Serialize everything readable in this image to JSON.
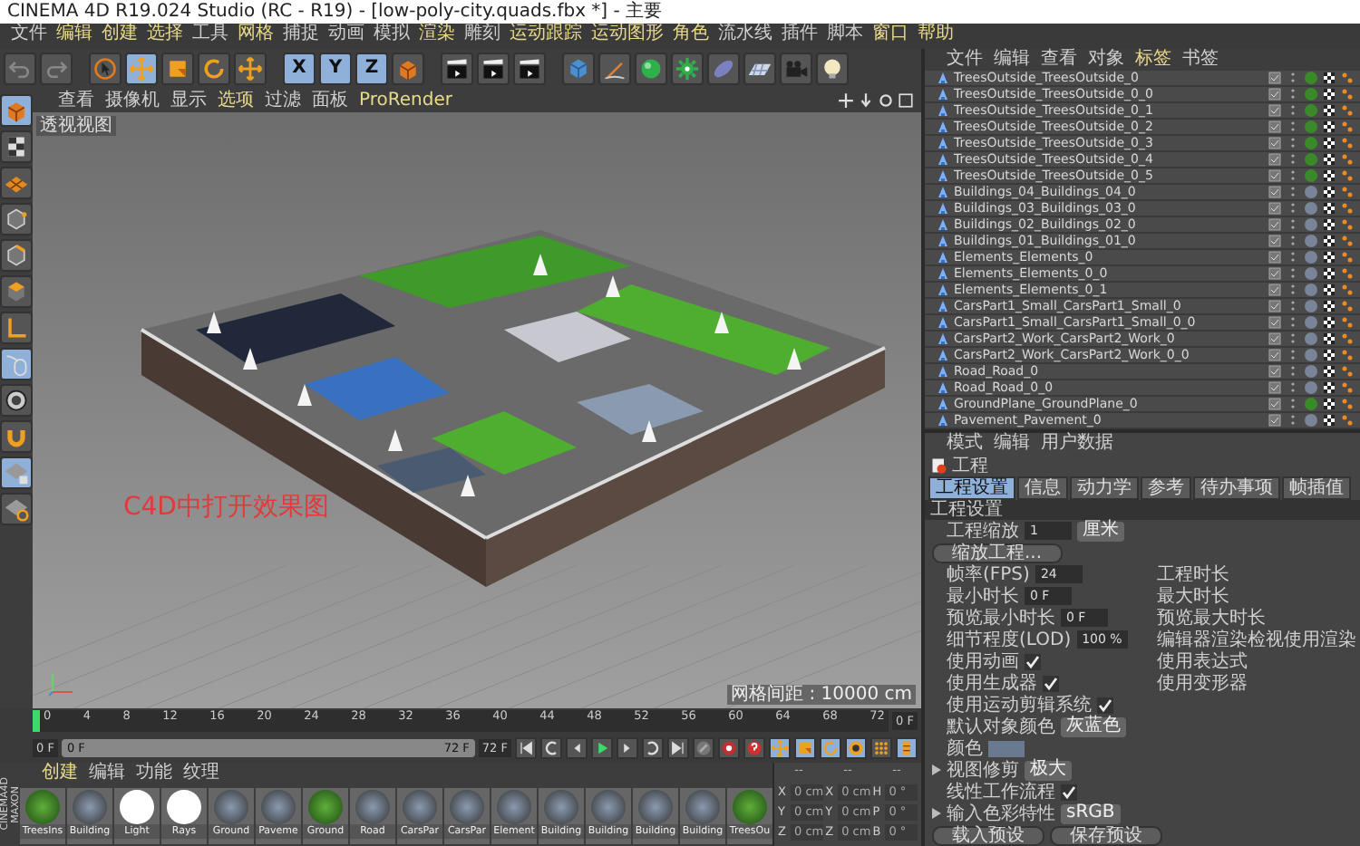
{
  "window": {
    "title": "CINEMA 4D R19.024 Studio (RC - R19) - [low-poly-city.quads.fbx *] - 主要"
  },
  "menu": [
    {
      "label": "文件",
      "highlighted": false
    },
    {
      "label": "编辑",
      "highlighted": true
    },
    {
      "label": "创建",
      "highlighted": true
    },
    {
      "label": "选择",
      "highlighted": true
    },
    {
      "label": "工具",
      "highlighted": false
    },
    {
      "label": "网格",
      "highlighted": true
    },
    {
      "label": "捕捉",
      "highlighted": false
    },
    {
      "label": "动画",
      "highlighted": false
    },
    {
      "label": "模拟",
      "highlighted": false
    },
    {
      "label": "渲染",
      "highlighted": true
    },
    {
      "label": "雕刻",
      "highlighted": false
    },
    {
      "label": "运动跟踪",
      "highlighted": true
    },
    {
      "label": "运动图形",
      "highlighted": true
    },
    {
      "label": "角色",
      "highlighted": true
    },
    {
      "label": "流水线",
      "highlighted": false
    },
    {
      "label": "插件",
      "highlighted": false
    },
    {
      "label": "脚本",
      "highlighted": false
    },
    {
      "label": "窗口",
      "highlighted": true
    },
    {
      "label": "帮助",
      "highlighted": true
    }
  ],
  "toolbar": {
    "axis_buttons": [
      {
        "label": "X",
        "on": true
      },
      {
        "label": "Y",
        "on": true
      },
      {
        "label": "Z",
        "on": true
      }
    ]
  },
  "viewport": {
    "menu": [
      {
        "label": "查看",
        "highlighted": false
      },
      {
        "label": "摄像机",
        "highlighted": false
      },
      {
        "label": "显示",
        "highlighted": false
      },
      {
        "label": "选项",
        "highlighted": true
      },
      {
        "label": "过滤",
        "highlighted": false
      },
      {
        "label": "面板",
        "highlighted": false
      },
      {
        "label": "ProRender",
        "highlighted": true
      }
    ],
    "view_label": "透视视图",
    "caption": "C4D中打开效果图",
    "grid_spacing": "网格间距 : 10000 cm"
  },
  "object_manager": {
    "tabs": [
      {
        "label": "文件",
        "highlighted": false
      },
      {
        "label": "编辑",
        "highlighted": false
      },
      {
        "label": "查看",
        "highlighted": false
      },
      {
        "label": "对象",
        "highlighted": false
      },
      {
        "label": "标签",
        "highlighted": true
      },
      {
        "label": "书签",
        "highlighted": false
      }
    ],
    "objects": [
      {
        "name": "TreesOutside_TreesOutside_0",
        "color": "#3a8a2a"
      },
      {
        "name": "TreesOutside_TreesOutside_0_0",
        "color": "#3a8a2a"
      },
      {
        "name": "TreesOutside_TreesOutside_0_1",
        "color": "#3a8a2a"
      },
      {
        "name": "TreesOutside_TreesOutside_0_2",
        "color": "#3a8a2a"
      },
      {
        "name": "TreesOutside_TreesOutside_0_3",
        "color": "#3a8a2a"
      },
      {
        "name": "TreesOutside_TreesOutside_0_4",
        "color": "#3a8a2a"
      },
      {
        "name": "TreesOutside_TreesOutside_0_5",
        "color": "#3a8a2a"
      },
      {
        "name": "Buildings_04_Buildings_04_0",
        "color": "#7a8498"
      },
      {
        "name": "Buildings_03_Buildings_03_0",
        "color": "#7a8498"
      },
      {
        "name": "Buildings_02_Buildings_02_0",
        "color": "#7a8498"
      },
      {
        "name": "Buildings_01_Buildings_01_0",
        "color": "#7a8498"
      },
      {
        "name": "Elements_Elements_0",
        "color": "#7a8498"
      },
      {
        "name": "Elements_Elements_0_0",
        "color": "#7a8498"
      },
      {
        "name": "Elements_Elements_0_1",
        "color": "#7a8498"
      },
      {
        "name": "CarsPart1_Small_CarsPart1_Small_0",
        "color": "#7a8498"
      },
      {
        "name": "CarsPart1_Small_CarsPart1_Small_0_0",
        "color": "#7a8498"
      },
      {
        "name": "CarsPart2_Work_CarsPart2_Work_0",
        "color": "#7a8498"
      },
      {
        "name": "CarsPart2_Work_CarsPart2_Work_0_0",
        "color": "#7a8498"
      },
      {
        "name": "Road_Road_0",
        "color": "#7a8498"
      },
      {
        "name": "Road_Road_0_0",
        "color": "#7a8498"
      },
      {
        "name": "GroundPlane_GroundPlane_0",
        "color": "#3a8a2a"
      },
      {
        "name": "Pavement_Pavement_0",
        "color": "#7a8498"
      }
    ]
  },
  "attributes": {
    "menu": [
      "模式",
      "编辑",
      "用户数据"
    ],
    "object_name": "工程",
    "tabs": [
      {
        "label": "工程设置",
        "selected": true
      },
      {
        "label": "信息",
        "selected": false
      },
      {
        "label": "动力学",
        "selected": false
      },
      {
        "label": "参考",
        "selected": false
      },
      {
        "label": "待办事项",
        "selected": false
      },
      {
        "label": "帧插值",
        "selected": false
      }
    ],
    "section": "工程设置",
    "rows": [
      {
        "left": {
          "kind": "scale",
          "label": "工程缩放",
          "value": "1",
          "unit": "厘米"
        }
      },
      {
        "left": {
          "kind": "button",
          "label": "缩放工程..."
        }
      },
      {
        "left": {
          "kind": "number",
          "label": "帧率(FPS)",
          "value": "24"
        },
        "right": {
          "kind": "label",
          "label": "工程时长"
        }
      },
      {
        "left": {
          "kind": "number",
          "label": "最小时长",
          "value": "0 F"
        },
        "right": {
          "kind": "label",
          "label": "最大时长"
        }
      },
      {
        "left": {
          "kind": "number",
          "label": "预览最小时长",
          "value": "0 F"
        },
        "right": {
          "kind": "label",
          "label": "预览最大时长"
        }
      },
      {
        "left": {
          "kind": "number",
          "label": "细节程度(LOD)",
          "value": "100 %"
        },
        "right": {
          "kind": "label",
          "label": "编辑器渲染检视使用渲染"
        }
      },
      {
        "left": {
          "kind": "check",
          "label": "使用动画",
          "checked": true
        },
        "right": {
          "kind": "label",
          "label": "使用表达式"
        }
      },
      {
        "left": {
          "kind": "check",
          "label": "使用生成器",
          "checked": true
        },
        "right": {
          "kind": "label",
          "label": "使用变形器"
        }
      },
      {
        "left": {
          "kind": "check",
          "label": "使用运动剪辑系统",
          "checked": true
        }
      },
      {
        "left": {
          "kind": "dropdown",
          "label": "默认对象颜色",
          "value": "灰蓝色"
        }
      },
      {
        "left": {
          "kind": "swatch",
          "label": "颜色"
        }
      },
      {
        "left": {
          "kind": "dropdown",
          "label": "视图修剪",
          "value": "极大",
          "expandable": true
        }
      },
      {
        "left": {
          "kind": "check",
          "label": "线性工作流程",
          "checked": true
        }
      },
      {
        "left": {
          "kind": "dropdown",
          "label": "输入色彩特性",
          "value": "sRGB",
          "expandable": true
        }
      },
      {
        "left": {
          "kind": "buttons",
          "labels": [
            "载入预设",
            "保存预设"
          ]
        }
      }
    ]
  },
  "timeline": {
    "ticks": [
      "0",
      "4",
      "8",
      "12",
      "16",
      "20",
      "24",
      "28",
      "32",
      "36",
      "40",
      "44",
      "48",
      "52",
      "56",
      "60",
      "64",
      "68",
      "72"
    ],
    "current_frame": "0 F",
    "level": 0,
    "start": "0 F",
    "range": {
      "start": "0 F",
      "end": "72 F",
      "level": 1
    },
    "end": "72 F"
  },
  "materials": {
    "brand": [
      "MAXON",
      "CINEMA4D"
    ],
    "tabs": [
      {
        "label": "创建",
        "highlighted": true
      },
      {
        "label": "编辑",
        "highlighted": false
      },
      {
        "label": "功能",
        "highlighted": false
      },
      {
        "label": "纹理",
        "highlighted": false
      }
    ],
    "items": [
      {
        "name": "TreesIns",
        "kind": "foliage"
      },
      {
        "name": "Building",
        "kind": "texture"
      },
      {
        "name": "Light",
        "kind": "white"
      },
      {
        "name": "Rays",
        "kind": "white"
      },
      {
        "name": "Ground",
        "kind": "texture"
      },
      {
        "name": "Paveme",
        "kind": "texture"
      },
      {
        "name": "Ground",
        "kind": "foliage"
      },
      {
        "name": "Road",
        "kind": "texture"
      },
      {
        "name": "CarsPar",
        "kind": "texture"
      },
      {
        "name": "CarsPar",
        "kind": "texture"
      },
      {
        "name": "Element",
        "kind": "texture"
      },
      {
        "name": "Building",
        "kind": "texture"
      },
      {
        "name": "Building",
        "kind": "texture"
      },
      {
        "name": "Building",
        "kind": "texture"
      },
      {
        "name": "Building",
        "kind": "texture"
      },
      {
        "name": "TreesOu",
        "kind": "foliage"
      }
    ]
  },
  "coordinates": {
    "headers": [
      "--",
      "--",
      "--"
    ],
    "rows": [
      [
        "X",
        "0 cm",
        "X",
        "0 cm",
        "H",
        "0 °"
      ],
      [
        "Y",
        "0 cm",
        "Y",
        "0 cm",
        "P",
        "0 °"
      ],
      [
        "Z",
        "0 cm",
        "Z",
        "0 cm",
        "B",
        "0 °"
      ]
    ]
  }
}
